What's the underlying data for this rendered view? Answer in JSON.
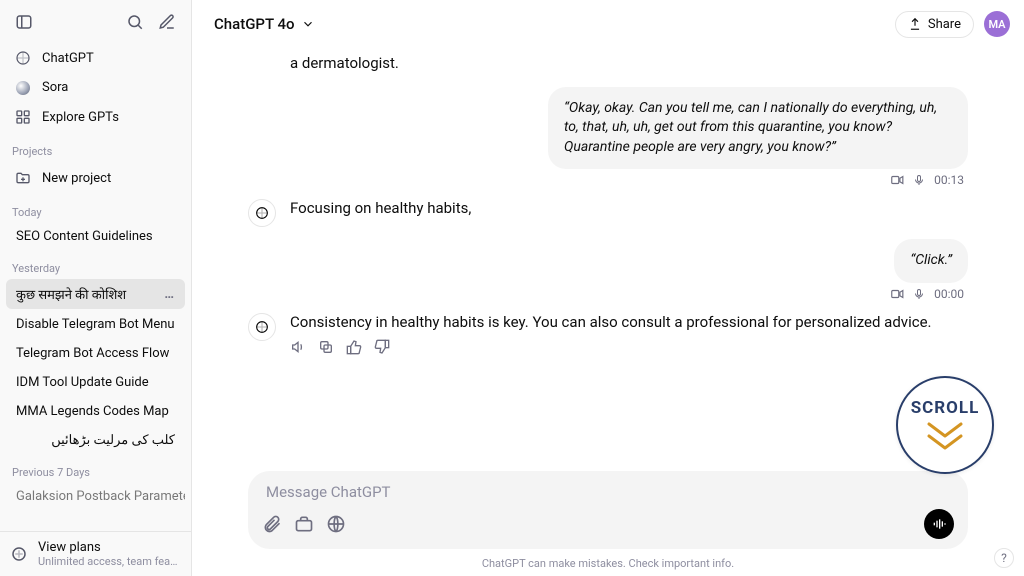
{
  "sidebar": {
    "nav": {
      "chatgpt": "ChatGPT",
      "sora": "Sora",
      "explore": "Explore GPTs"
    },
    "sections": {
      "projects_label": "Projects",
      "new_project": "New project",
      "today_label": "Today",
      "yesterday_label": "Yesterday",
      "prev7_label": "Previous 7 Days"
    },
    "history": {
      "today": [
        "SEO Content Guidelines"
      ],
      "yesterday": [
        "कुछ समझने की कोशिश",
        "Disable Telegram Bot Menu",
        "Telegram Bot Access Flow",
        "IDM Tool Update Guide",
        "MMA Legends Codes Map",
        "کلب کی مرلیت بڑھائیں"
      ],
      "prev7": [
        "Galaksion Postback Parameters"
      ]
    },
    "bottom": {
      "title": "View plans",
      "subtitle": "Unlimited access, team features,"
    }
  },
  "header": {
    "model": "ChatGPT 4o",
    "share": "Share",
    "avatar_initials": "MA"
  },
  "conversation": {
    "msg0_assistant_tail": "a dermatologist.",
    "msg1_user": "“Okay, okay. Can you tell me, can I nationally do everything, uh, to, that, uh, uh, get out from this quarantine, you know? Quarantine people are very angry, you know?”",
    "msg1_time": "00:13",
    "msg2_assistant": "Focusing on healthy habits,",
    "msg3_user": "“Click.”",
    "msg3_time": "00:00",
    "msg4_assistant": "Consistency in healthy habits is key. You can also consult a professional for personalized advice."
  },
  "composer": {
    "placeholder": "Message ChatGPT"
  },
  "footer": {
    "note": "ChatGPT can make mistakes. Check important info."
  },
  "overlay": {
    "scroll_label": "SCROLL"
  },
  "help": {
    "label": "?"
  }
}
